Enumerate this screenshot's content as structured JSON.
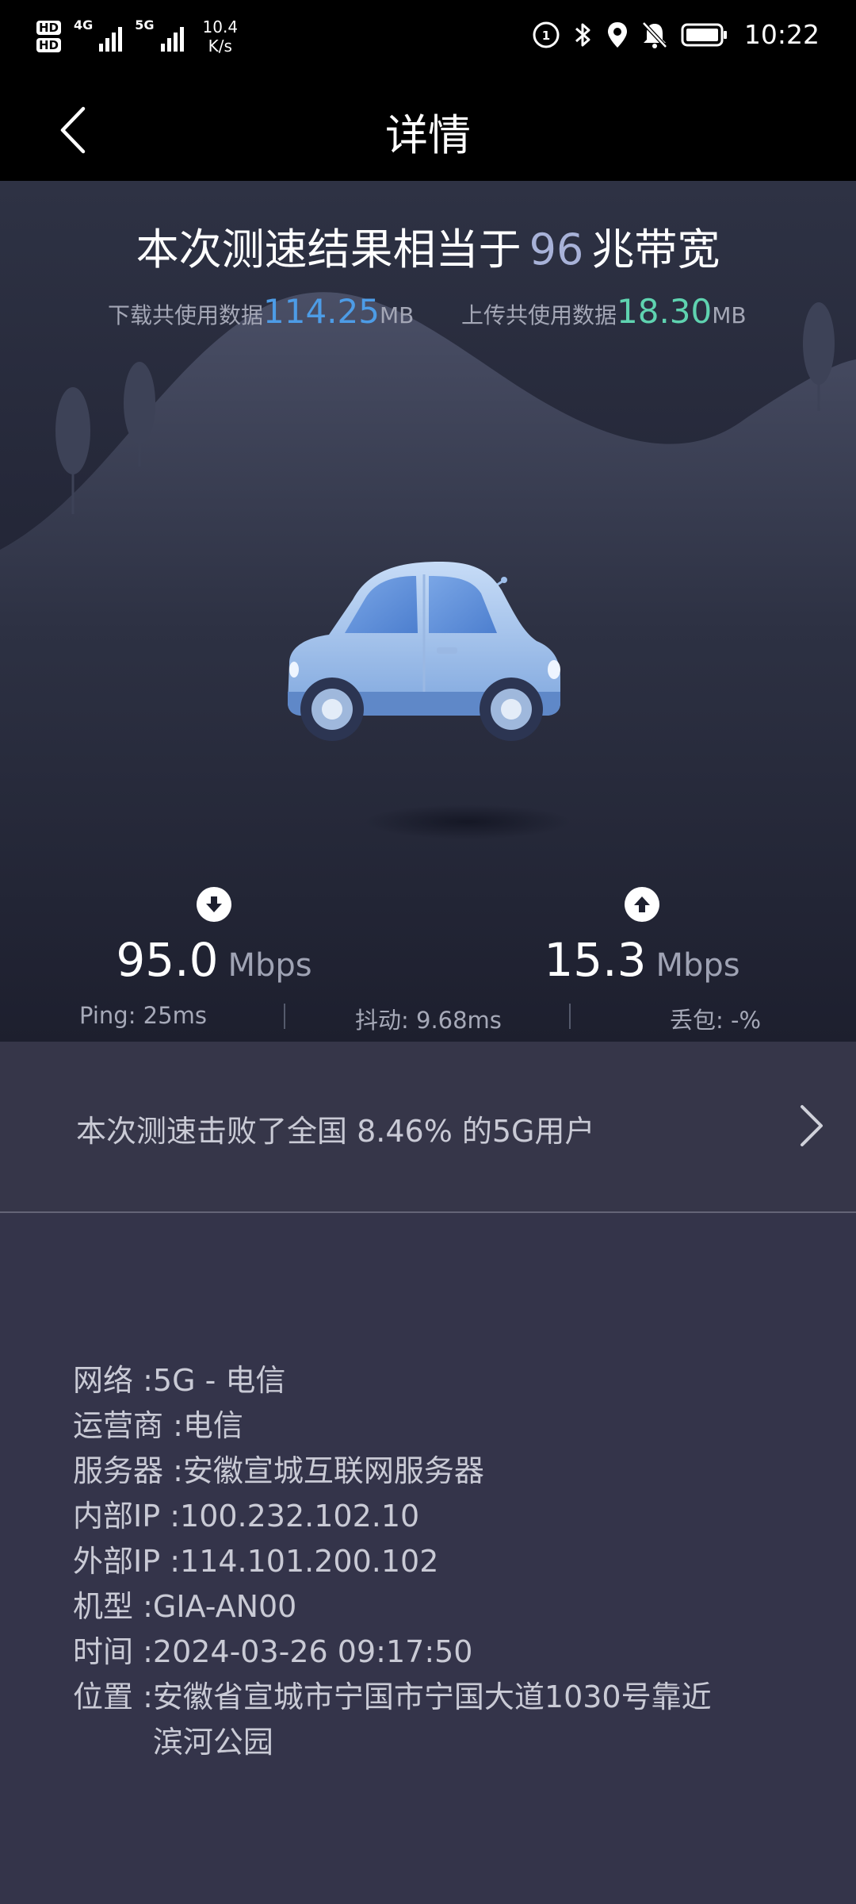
{
  "status_bar": {
    "hd1": "HD",
    "hd2": "HD",
    "net1": "4G",
    "net2": "5G",
    "speed_value": "10.4",
    "speed_unit": "K/s",
    "time": "10:22"
  },
  "header": {
    "title": "详情"
  },
  "summary": {
    "prefix": "本次测速结果相当于",
    "bandwidth": "96",
    "suffix": "兆带宽",
    "download_label": "下载共使用数据",
    "download_value": "114.25",
    "download_unit": "MB",
    "upload_label": "上传共使用数据",
    "upload_value": "18.30",
    "upload_unit": "MB"
  },
  "speed": {
    "download_value": "95.0",
    "download_unit": "Mbps",
    "upload_value": "15.3",
    "upload_unit": "Mbps"
  },
  "stats": {
    "ping": "Ping:  25ms",
    "jitter": "抖动:  9.68ms",
    "loss": "丢包:  -%"
  },
  "rank": {
    "text": "本次测速击败了全国 8.46% 的5G用户"
  },
  "details": {
    "network_label": "网络  :  ",
    "network_value": "5G - 电信",
    "carrier_label": "运营商 : ",
    "carrier_value": "电信",
    "server_label": "服务器 : ",
    "server_value": "安徽宣城互联网服务器",
    "internal_ip_label": "内部IP  :  ",
    "internal_ip_value": "100.232.102.10",
    "external_ip_label": "外部IP  :  ",
    "external_ip_value": "114.101.200.102",
    "model_label": "机型  :  ",
    "model_value": "GIA-AN00",
    "time_label": "时间  :  ",
    "time_value": "2024-03-26 09:17:50",
    "location_label": "位置  :  ",
    "location_value": "安徽省宣城市宁国市宁国大道1030号靠近滨河公园"
  },
  "colors": {
    "download_accent": "#4d9ce6",
    "upload_accent": "#5fd3b0",
    "bandwidth_accent": "#a8b2d8"
  }
}
